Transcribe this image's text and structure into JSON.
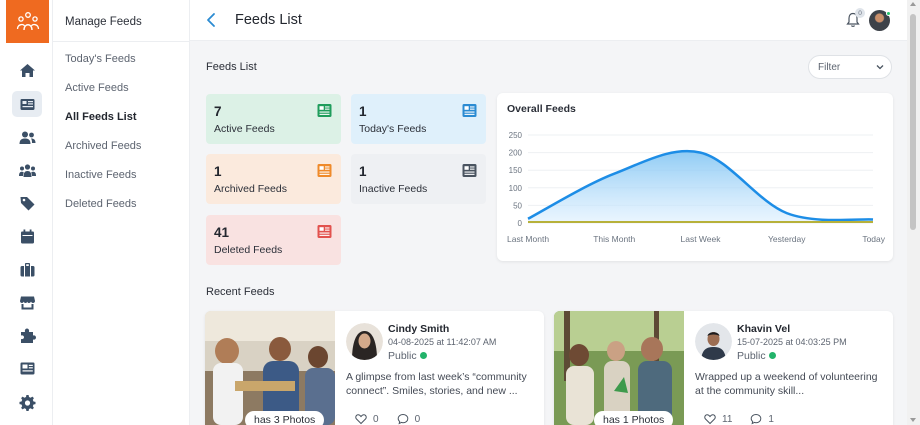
{
  "header": {
    "title": "Feeds List",
    "notifications_count": "0"
  },
  "menu": {
    "title": "Manage Feeds",
    "items": [
      {
        "label": "Today's Feeds",
        "active": false
      },
      {
        "label": "Active Feeds",
        "active": false
      },
      {
        "label": "All Feeds List",
        "active": true
      },
      {
        "label": "Archived Feeds",
        "active": false
      },
      {
        "label": "Inactive Feeds",
        "active": false
      },
      {
        "label": "Deleted Feeds",
        "active": false
      }
    ]
  },
  "rail": {
    "icons": [
      "home-icon",
      "feeds-icon",
      "users-icon",
      "groups-icon",
      "tags-icon",
      "calendar-icon",
      "briefcase-icon",
      "store-icon",
      "puzzle-icon",
      "news-icon",
      "settings-icon"
    ],
    "active": "feeds-icon"
  },
  "feeds_section": {
    "label": "Feeds List",
    "filter_label": "Filter"
  },
  "stats": [
    {
      "value": "7",
      "label": "Active Feeds",
      "color": "#dcf1e6",
      "icon_color": "#1f9d5c"
    },
    {
      "value": "1",
      "label": "Today's Feeds",
      "color": "#dff0fb",
      "icon_color": "#2b8bd2"
    },
    {
      "value": "1",
      "label": "Archived Feeds",
      "color": "#fbeadd",
      "icon_color": "#ef8a2a"
    },
    {
      "value": "1",
      "label": "Inactive Feeds",
      "color": "#eef0f3",
      "icon_color": "#4a5460"
    },
    {
      "value": "41",
      "label": "Deleted Feeds",
      "color": "#f9e2e1",
      "icon_color": "#e2524e"
    }
  ],
  "chart_data": {
    "type": "area",
    "title": "Overall Feeds",
    "categories": [
      "Last Month",
      "This Month",
      "Last Week",
      "Yesterday",
      "Today"
    ],
    "x": [
      0,
      1,
      2,
      3,
      4
    ],
    "series": [
      {
        "values": [
          12,
          140,
          200,
          28,
          10
        ],
        "color": "#1d8de6"
      },
      {
        "values": [
          0,
          0,
          0,
          0,
          0
        ],
        "color": "#b7b13a"
      }
    ],
    "y_ticks": [
      0,
      50,
      100,
      150,
      200,
      250
    ],
    "ylim": [
      0,
      250
    ],
    "grid": true
  },
  "recent": {
    "label": "Recent Feeds",
    "feeds": [
      {
        "name": "Cindy Smith",
        "date": "04-08-2025 at 11:42:07 AM",
        "visibility": "Public",
        "text": "A glimpse from last week’s “community connect”. Smiles, stories, and new ...",
        "photos": "has 3 Photos",
        "likes": "0",
        "comments": "0"
      },
      {
        "name": "Khavin Vel",
        "date": "15-07-2025 at 04:03:25 PM",
        "visibility": "Public",
        "text": "Wrapped up a weekend of volunteering at the community skill... ",
        "photos": "has 1 Photos",
        "likes": "11",
        "comments": "1"
      }
    ]
  }
}
